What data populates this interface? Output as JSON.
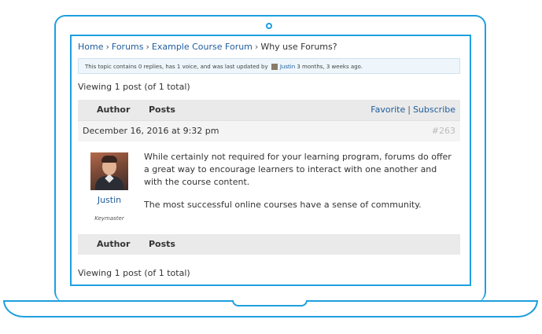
{
  "breadcrumb": {
    "home": "Home",
    "forums": "Forums",
    "course_forum": "Example Course Forum",
    "current": "Why use Forums?",
    "separator": "›"
  },
  "notice": {
    "text_before": "This topic contains 0 replies, has 1 voice, and was last updated by",
    "user": "Justin",
    "text_after": "3 months, 3 weeks ago."
  },
  "viewing_top": "Viewing 1 post (of 1 total)",
  "header": {
    "author": "Author",
    "posts": "Posts",
    "favorite": "Favorite",
    "separator": "|",
    "subscribe": "Subscribe"
  },
  "post": {
    "date": "December 16, 2016 at 9:32 pm",
    "id": "#263",
    "author_name": "Justin",
    "author_role": "Keymaster",
    "paragraphs": [
      "While certainly not required for your learning program, forums do offer a great way to encourage learners to interact with one another and with the course content.",
      "The most successful online courses have a sense of community."
    ]
  },
  "footer": {
    "author": "Author",
    "posts": "Posts"
  },
  "viewing_bottom": "Viewing 1 post (of 1 total)",
  "colors": {
    "frame": "#1e9fdf",
    "link": "#1e5c9c"
  }
}
